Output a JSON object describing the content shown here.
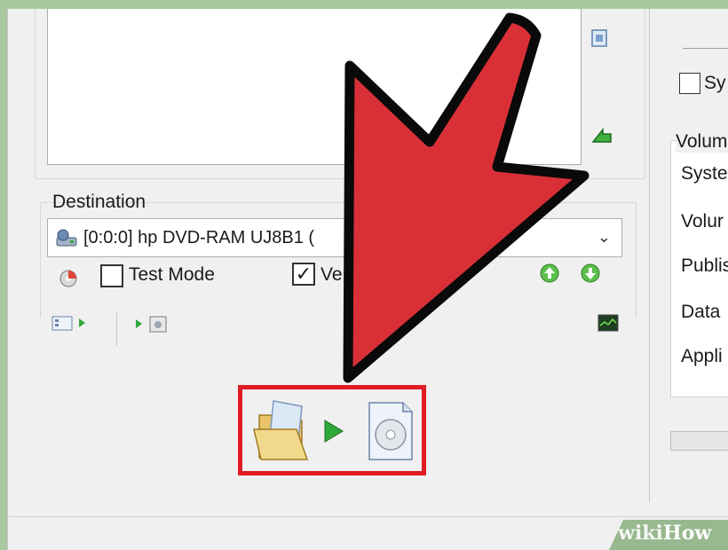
{
  "destination": {
    "label": "Destination",
    "device": "[0:0:0] hp DVD-RAM UJ8B1 ("
  },
  "options": {
    "test_mode_label": "Test Mode",
    "test_mode_checked": false,
    "verify_label": "Ve",
    "verify_checked": true
  },
  "right_panel": {
    "checkbox_label": "Sy",
    "group_title": "Volum",
    "fields": [
      "Syster",
      "Volur",
      "Publis",
      "Data",
      "Appli"
    ]
  },
  "watermark": {
    "prefix": "wiki",
    "suffix": "How"
  },
  "colors": {
    "arrow": "#d93038",
    "highlight": "#e01b24",
    "green": "#2fa83a"
  }
}
